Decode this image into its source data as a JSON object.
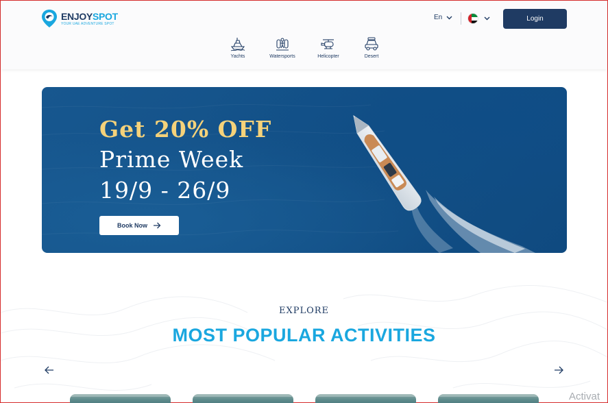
{
  "brand": {
    "name_part1": "ENJOY",
    "name_part2": "SPOT",
    "tagline": "YOUR UAE ADVENTURE SPOT"
  },
  "header": {
    "language": "En",
    "login_label": "Login"
  },
  "nav": {
    "items": [
      {
        "label": "Yachts",
        "icon": "yacht-icon"
      },
      {
        "label": "Watersports",
        "icon": "watersports-icon"
      },
      {
        "label": "Helicopter",
        "icon": "helicopter-icon"
      },
      {
        "label": "Desert",
        "icon": "desert-car-icon"
      }
    ]
  },
  "banner": {
    "line1": "Get 20% OFF",
    "line2": "Prime Week",
    "line3": "19/9 - 26/9",
    "cta_label": "Book Now"
  },
  "explore": {
    "eyebrow": "EXPLORE",
    "title": "MOST POPULAR ACTIVITIES"
  },
  "system": {
    "watermark": "Activat"
  },
  "colors": {
    "navy": "#1f3b63",
    "accent_blue": "#1aa7df",
    "promo_gold": "#f5d27a",
    "sea_blue": "#145289"
  }
}
